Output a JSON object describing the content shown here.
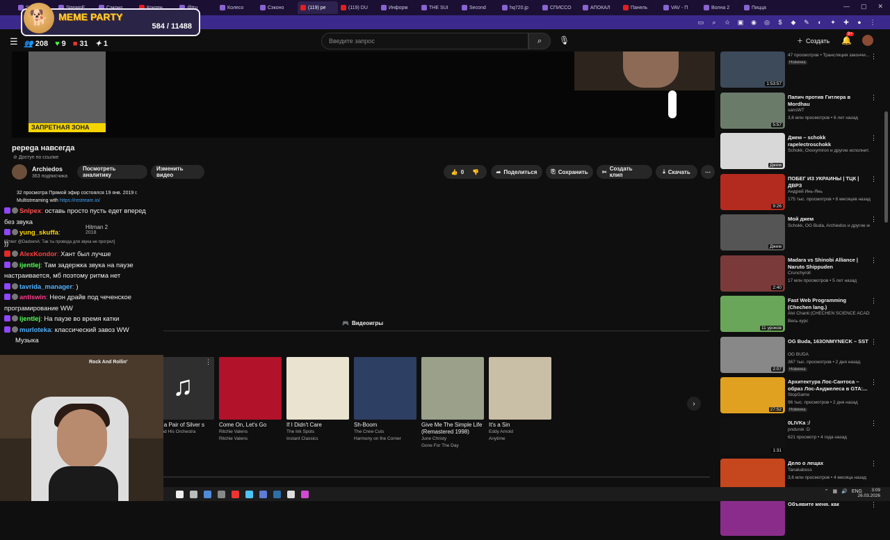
{
  "browser": {
    "tabs": [
      {
        "label": "StreamV",
        "kind": "twitch"
      },
      {
        "label": "StreamE",
        "kind": "twitch"
      },
      {
        "label": "Сэконо",
        "kind": "twitch"
      },
      {
        "label": "Контен",
        "kind": "yt"
      },
      {
        "label": "@tru",
        "kind": "twitch"
      },
      {
        "label": "Колесо",
        "kind": "twitch"
      },
      {
        "label": "Сэконо",
        "kind": "twitch"
      },
      {
        "label": "(119) pe",
        "kind": "yt",
        "active": true
      },
      {
        "label": "(119) DU",
        "kind": "yt"
      },
      {
        "label": "Информ",
        "kind": "twitch"
      },
      {
        "label": "THE SUI",
        "kind": "twitch"
      },
      {
        "label": "Second",
        "kind": "twitch"
      },
      {
        "label": "hq720.jp",
        "kind": "twitch"
      },
      {
        "label": "СПИССО",
        "kind": "twitch"
      },
      {
        "label": "АПОКАЛ",
        "kind": "twitch"
      },
      {
        "label": "Панель",
        "kind": "yt"
      },
      {
        "label": "VAV - П",
        "kind": "twitch"
      },
      {
        "label": "Волна 2",
        "kind": "twitch"
      },
      {
        "label": "Пицца",
        "kind": "twitch"
      }
    ]
  },
  "overlay": {
    "title": "MEME PARTY",
    "count": "584 / 11488"
  },
  "stream_stats": {
    "viewers": "208",
    "likes": "9",
    "live": "31",
    "other": "1"
  },
  "header": {
    "search_placeholder": "Введите запрос",
    "create_label": "Создать",
    "notif_badge": "9+"
  },
  "video": {
    "zone_label": "ЗАПРЕТНАЯ ЗОНА"
  },
  "watch": {
    "title": "pepega навсегда",
    "access": "Доступ по ссылке",
    "channel": "Archiedos",
    "subs": "363 подписчика",
    "analytics": "Посмотреть аналитику",
    "edit": "Изменить видео",
    "likes": "0",
    "share": "Поделиться",
    "save": "Сохранить",
    "clip": "Создать клип",
    "download": "Скачать",
    "desc_line1": "32 просмотра  Прямой эфир состоялся 19 янв. 2019 г.",
    "desc_line2": "Multistreaming with ",
    "desc_link": "https://restream.io/"
  },
  "game_card": {
    "name": "Hitman 2",
    "year": "2018",
    "label": "Игры"
  },
  "chat": [
    {
      "user": "Snlpex",
      "color": "#ff4f4f",
      "text": "оставь просто пусть едет вперед без звука",
      "badge": "sub"
    },
    {
      "user": "yung_skuffa",
      "color": "#ffd700",
      "text": "",
      "badge": "sub"
    },
    {
      "user": "",
      "color": "#fff",
      "text": "))",
      "badge": ""
    },
    {
      "user": "AlexKondor",
      "color": "#ff4040",
      "text": "Хант был лучше",
      "badge": "red"
    },
    {
      "user": "ijentlej",
      "color": "#55ff55",
      "text": "Там задержка звука на паузе настраивается, мб поэтому ритма нет",
      "badge": "sub"
    },
    {
      "user": "tavrida_manager",
      "color": "#4fb0ff",
      "text": ")",
      "badge": "sub"
    },
    {
      "user": "antiswin",
      "color": "#ff3c8c",
      "text": "Неон драйв под чеченское програмирование WW",
      "badge": "sub"
    },
    {
      "user": "ijentlej",
      "color": "#55ff55",
      "text": "На паузе во время катки",
      "badge": "sub"
    },
    {
      "user": "murloteka",
      "color": "#4fb0ff",
      "text": "классический завоз WW",
      "badge": "sub"
    }
  ],
  "chat_reply_note": "[Ответ @DadoenA: Так ты провода для звука не прогрел]",
  "music_label": "Музыка",
  "section_label": "Видеоигры",
  "albums": [
    {
      "title": "ears a Pair of Silver s",
      "artist": "yer and His Orchestra",
      "extra": "",
      "cover": "#2f2f2f"
    },
    {
      "title": "Come On, Let's Go",
      "artist": "Ritchie Valens",
      "extra": "Ritchie Valens",
      "cover": "#b3122b"
    },
    {
      "title": "If I Didn't Care",
      "artist": "The Ink Spots",
      "extra": "Instant Classics",
      "cover": "#e9e3cf"
    },
    {
      "title": "Sh-Boom",
      "artist": "The Crew Cuts",
      "extra": "Harmony on the Corner",
      "cover": "#2d3f63"
    },
    {
      "title": "Give Me The Simple Life (Remastered 1998)",
      "artist": "June Christy",
      "extra": "Gone For The Day",
      "cover": "#9aa08a"
    },
    {
      "title": "It's a Sin",
      "artist": "Eddy Arnold",
      "extra": "Anytime",
      "cover": "#c9bfa6"
    }
  ],
  "album_top_label": "Rock And Rollin'",
  "sidebar": [
    {
      "title": "",
      "channel": "47 просмотров • Трансляция закончи...",
      "meta": "",
      "new": "Новинка",
      "dur": "1:53:57",
      "color": "#3d4a5a"
    },
    {
      "title": "Папич против Гитлера в Mordhau",
      "channel": "sansWT",
      "meta": "3,6 млн просмотров • 6 лет назад",
      "new": "",
      "dur": "5:57",
      "color": "#6b7b6a"
    },
    {
      "title": "Джем – schokk rapelectroschokk",
      "channel": "Schokk, Oxxxymiron и другие исполнит...",
      "meta": "",
      "new": "",
      "dur": "Джем",
      "color": "#d8d8d8"
    },
    {
      "title": "ПОБЕГ ИЗ УКРАИНЫ | ТЦК | ДВРЗ",
      "channel": "Андрей Инь-Янь",
      "meta": "175 тыс. просмотров • 8 месяцев назад",
      "new": "",
      "dur": "9:26",
      "color": "#b32a1f"
    },
    {
      "title": "Мой джем",
      "channel": "Schokk, OG Buda, Archiedos и другие ис...",
      "meta": "",
      "new": "",
      "dur": "Джем",
      "color": "#555555"
    },
    {
      "title": "Madara vs Shinobi Alliance | Naruto Shippuden",
      "channel": "Crunchyroll",
      "meta": "17 млн просмотров • 5 лет назад",
      "new": "",
      "dur": "2:40",
      "color": "#7a3a3a"
    },
    {
      "title": "Fast Web Programming (Chechen lang.)",
      "channel": "Alvi Chanti (CHECHEN SCIENCE ACADEMY)",
      "meta": "Весь курс",
      "new": "",
      "dur": "11 уроков",
      "color": "#6aa65a"
    },
    {
      "title": "OG Buda, 163ONMYNECK – SST",
      "channel": "OG BUDA",
      "meta": "367 тыс. просмотров • 2 дня назад",
      "new": "Новинка",
      "dur": "2:07",
      "color": "#888888"
    },
    {
      "title": "Архитектура Лос-Сантоса – образ Лос-Анджелеса в GTA:...",
      "channel": "StopGame",
      "meta": "96 тыс. просмотров • 2 дня назад",
      "new": "Новинка",
      "dur": "27:52",
      "color": "#e0a020"
    },
    {
      "title": "0LIVKa :/",
      "channel": "pndurok :D",
      "meta": "621 просмотр • 4 года назад",
      "new": "",
      "dur": "1:31",
      "color": "#111111"
    },
    {
      "title": "Дело о лещах",
      "channel": "Tanakaboss",
      "meta": "3,6 млн просмотров • 4 месяца назад",
      "new": "",
      "dur": "21:37",
      "color": "#c6461e"
    },
    {
      "title": "Объявите меня. как",
      "channel": "",
      "meta": "",
      "new": "",
      "dur": "",
      "color": "#8a2d8a"
    }
  ],
  "taskbar": {
    "lang": "ENG",
    "time": "3:09",
    "date": "26.03.2026"
  }
}
